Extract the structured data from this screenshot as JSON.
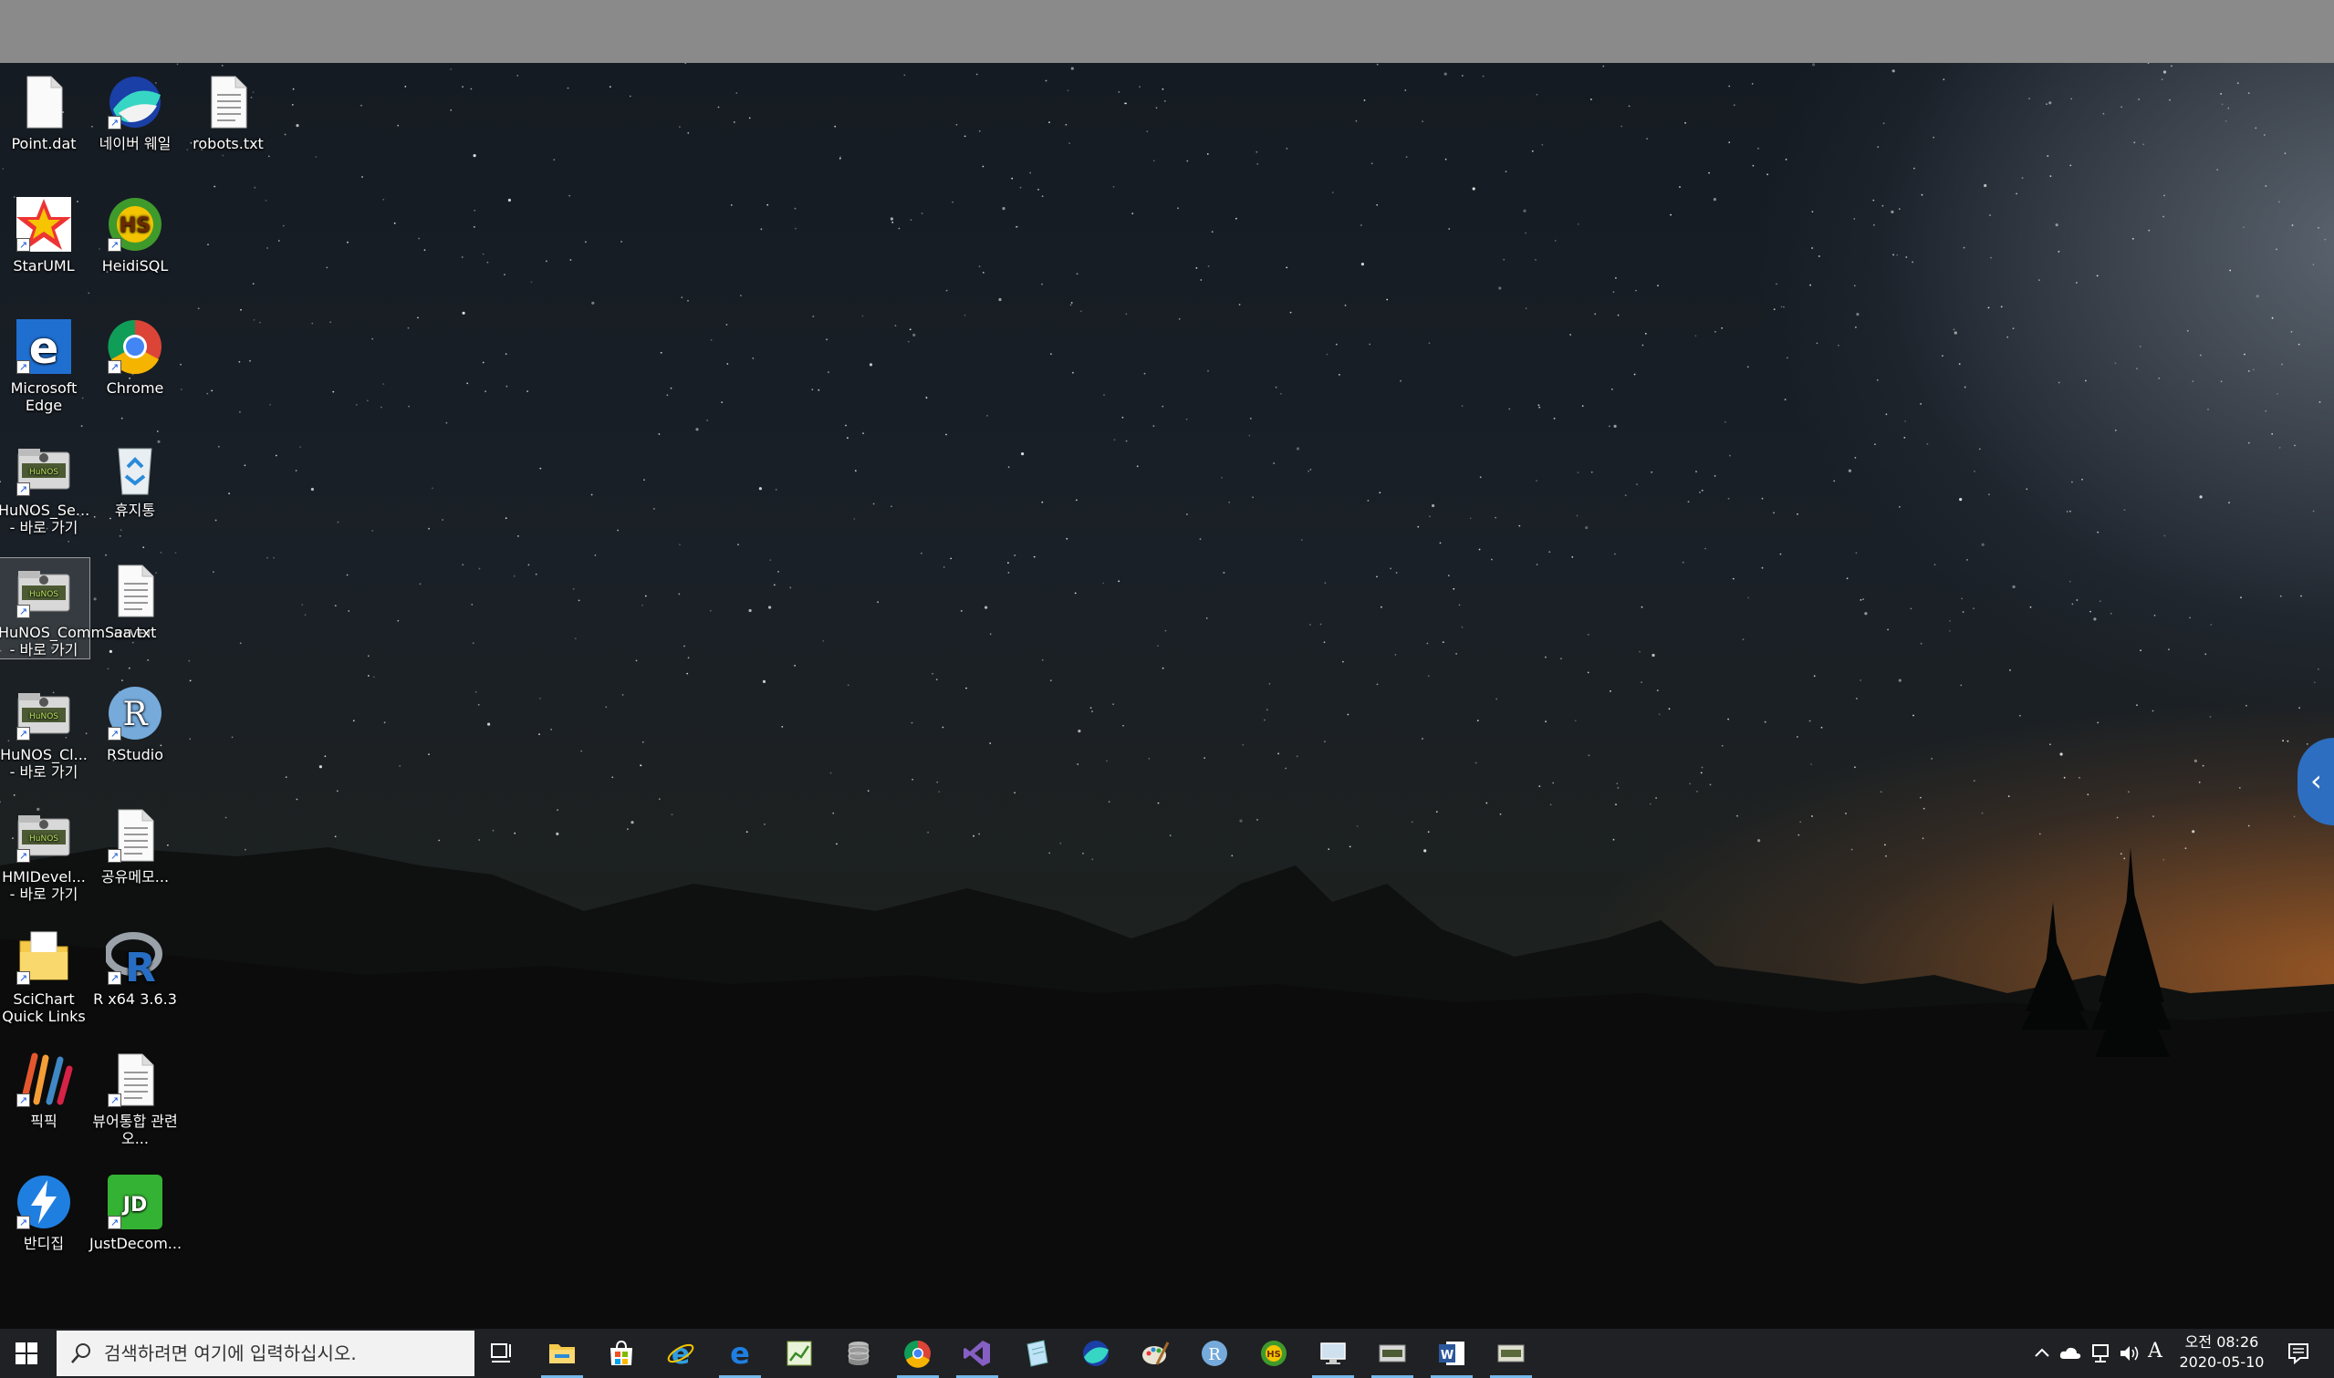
{
  "desktop": {
    "icons": [
      {
        "label": "Point.dat",
        "icon": "file-icon"
      },
      {
        "label": "네이버 웨일",
        "icon": "naver-whale-icon"
      },
      {
        "label": "robots.txt",
        "icon": "text-file-icon"
      },
      {
        "label": "StarUML",
        "icon": "staruml-icon"
      },
      {
        "label": "HeidiSQL",
        "icon": "heidisql-icon"
      },
      {
        "label": "Microsoft Edge",
        "icon": "edge-icon"
      },
      {
        "label": "Chrome",
        "icon": "chrome-icon"
      },
      {
        "label": "HuNOS_Se... - 바로 가기",
        "icon": "hunos-folder-icon"
      },
      {
        "label": "휴지통",
        "icon": "recycle-bin-icon"
      },
      {
        "label": "HuNOS_CommServer - 바로 가기",
        "icon": "hunos-folder-icon"
      },
      {
        "label": "aa.txt",
        "icon": "text-file-icon"
      },
      {
        "label": "HuNOS_Cl... - 바로 가기",
        "icon": "hunos-folder-icon"
      },
      {
        "label": "RStudio",
        "icon": "rstudio-icon"
      },
      {
        "label": "HMIDevel... - 바로 가기",
        "icon": "hunos-folder-icon"
      },
      {
        "label": "공유메모...",
        "icon": "text-file-icon"
      },
      {
        "label": "SciChart Quick Links",
        "icon": "folder-icon"
      },
      {
        "label": "R x64 3.6.3",
        "icon": "r-icon"
      },
      {
        "label": "픽픽",
        "icon": "picpick-icon"
      },
      {
        "label": "뷰어통합 관련 오...",
        "icon": "text-file-icon"
      },
      {
        "label": "반디집",
        "icon": "bandizip-icon"
      },
      {
        "label": "JustDecom...",
        "icon": "justdecompile-icon"
      }
    ],
    "selected_icon": "HuNOS_CommServer - 바로 가기"
  },
  "taskbar": {
    "search_placeholder": "검색하려면 여기에 입력하십시오.",
    "apps": [
      "task-view",
      "file-explorer",
      "microsoft-store",
      "internet-explorer",
      "edge",
      "chart-app",
      "database",
      "chrome",
      "visual-studio",
      "notepad",
      "naver-whale",
      "paint",
      "rstudio",
      "heidisql",
      "remote-desktop",
      "hunos-window",
      "word",
      "hunos-window-2"
    ],
    "tray": {
      "ime": "A",
      "time": "오전 08:26",
      "date": "2020-05-10"
    }
  },
  "colors": {
    "taskbar": "#202124",
    "running_indicator": "#76b9ed",
    "side_tab": "#2d6ec0"
  }
}
